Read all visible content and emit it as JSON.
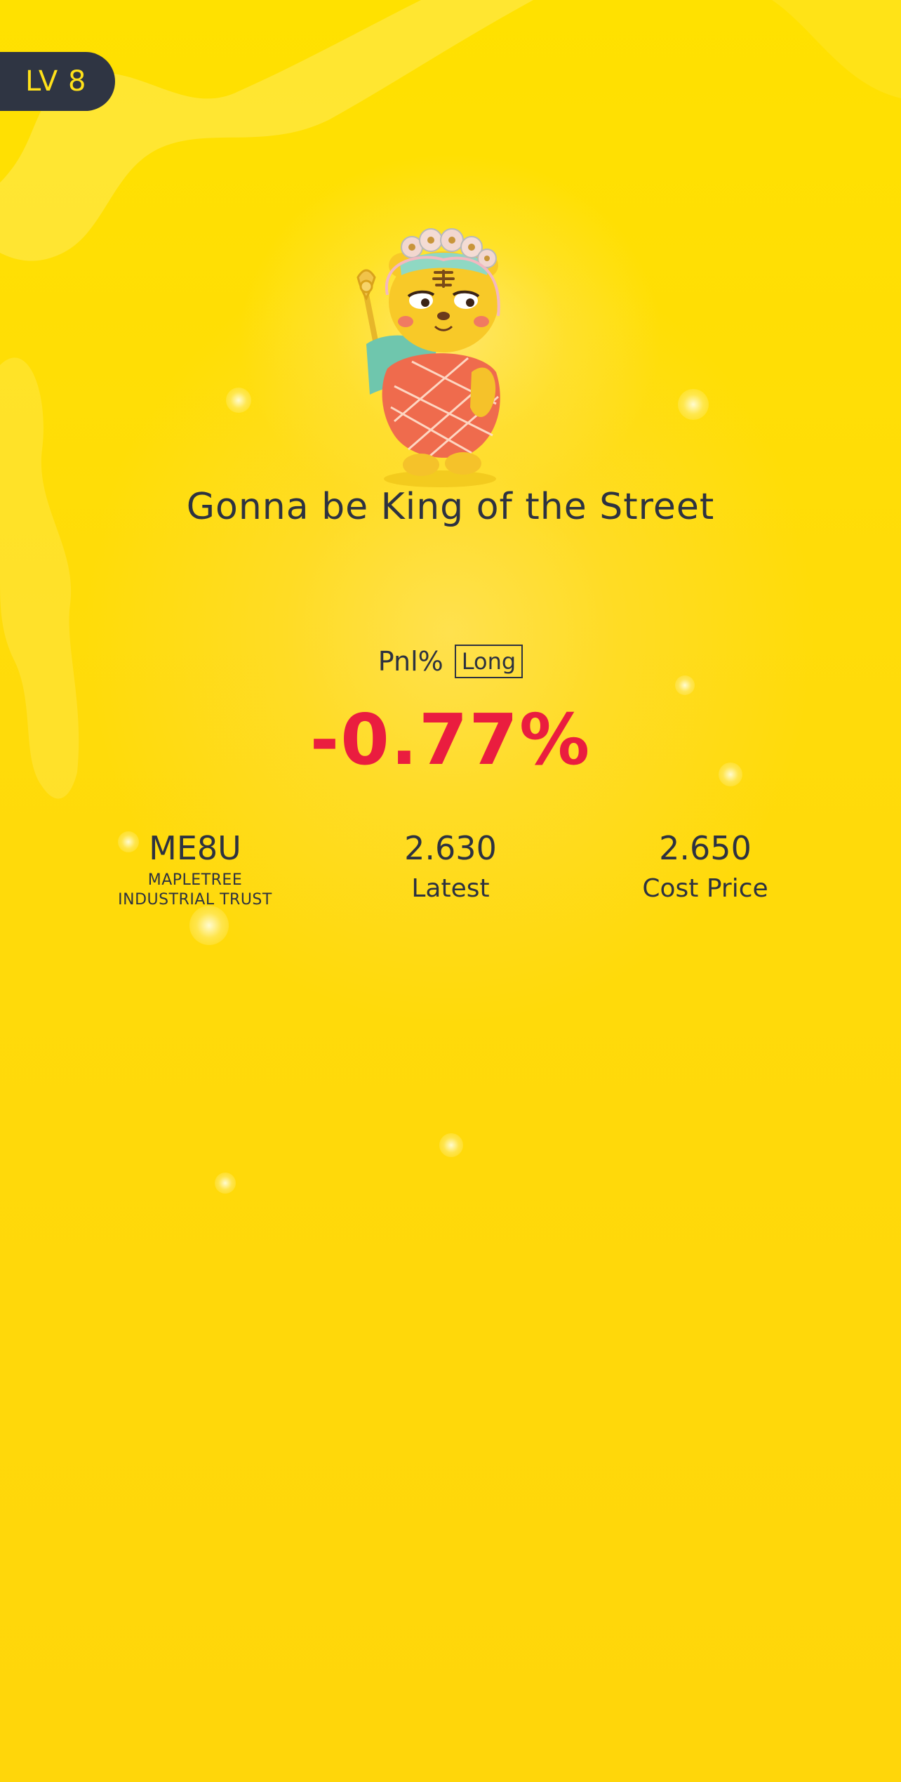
{
  "badge": {
    "level": "LV 8"
  },
  "mascot": {
    "icon": "tiger-king-mascot-icon"
  },
  "title": "Gonna be King of the Street",
  "pnl": {
    "label": "Pnl%",
    "direction": "Long",
    "value": "-0.77%",
    "color": "#ea1d3f"
  },
  "stats": {
    "symbol": "ME8U",
    "name_line1": "MAPLETREE",
    "name_line2": "INDUSTRIAL TRUST",
    "latest_value": "2.630",
    "latest_label": "Latest",
    "cost_value": "2.650",
    "cost_label": "Cost Price"
  },
  "colors": {
    "background": "#ffd90f",
    "badge_bg": "#2f3543",
    "badge_text": "#ffe11a",
    "text": "#2d3240"
  }
}
